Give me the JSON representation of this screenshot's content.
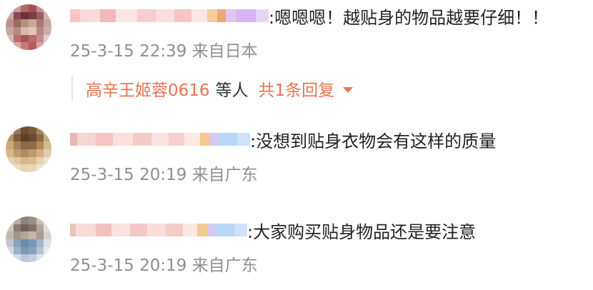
{
  "comments": [
    {
      "text": ":嗯嗯嗯！越贴身的物品越要仔细！！",
      "meta": "25-3-15 22:39 来自日本",
      "reply": {
        "user": "高辛王姬蓉0616",
        "etc": "等人",
        "count_label": "共1条回复"
      }
    },
    {
      "text": ":没想到贴身衣物会有这样的质量",
      "meta": "25-3-15 20:19 来自广东"
    },
    {
      "text": ":大家购买贴身物品还是要注意",
      "meta": "25-3-15 20:19 来自广东"
    }
  ],
  "colors": {
    "accent": "#eb7350",
    "meta_text": "#8f8f8f",
    "body_text": "#222222"
  },
  "icons": {
    "reply_expand": "caret-down-icon"
  }
}
